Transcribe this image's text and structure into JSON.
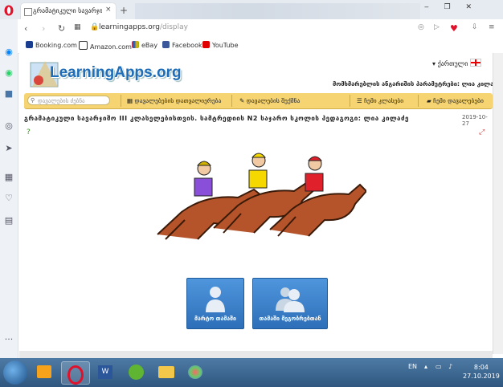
{
  "browser": {
    "tab_title": "გრამატიკული სავარჯიშო",
    "new_tab": "+",
    "tab_close": "×",
    "window_controls": "‒ ❐ ✕",
    "url_host": "learningapps.org",
    "url_path": "/display",
    "bookmarks": [
      {
        "label": "Booking.com",
        "color": "#1b3d8f",
        "icon": "B"
      },
      {
        "label": "Amazon.com",
        "color": "#ffffff",
        "icon": "a"
      },
      {
        "label": "eBay",
        "color": "#ffffff",
        "icon": "e"
      },
      {
        "label": "Facebook",
        "color": "#3b5998",
        "icon": "f"
      },
      {
        "label": "YouTube",
        "color": "#e00000",
        "icon": "▶"
      }
    ]
  },
  "page": {
    "logo": "LearningApps.org",
    "language": "ქართული",
    "user_line": "მომხმარებლის ანგარიშის პარამეტრები: ლია კილაძე",
    "search_placeholder": "დავალების ძებნა",
    "nav": [
      {
        "icon": "▦",
        "label": "დავალებების დათვალიერება"
      },
      {
        "icon": "✎",
        "label": "დავალების შექმნა"
      },
      {
        "icon": "☰",
        "label": "ჩემი კლასები"
      },
      {
        "icon": "▰",
        "label": "ჩემი დავალებები"
      }
    ],
    "title": "გრამატიკული სავარჯიშო III კლასელებისთვის. სამტრედიის N2 საჯარო სკოლის პედაგოგი: ლია კილაძე",
    "date": "2019-10-27",
    "buttons": [
      {
        "label": "მარტო თამაში"
      },
      {
        "label": "თამაში მეგობრებთან"
      }
    ]
  },
  "taskbar": {
    "language": "EN",
    "time": "8:04",
    "date": "27.10.2019"
  }
}
